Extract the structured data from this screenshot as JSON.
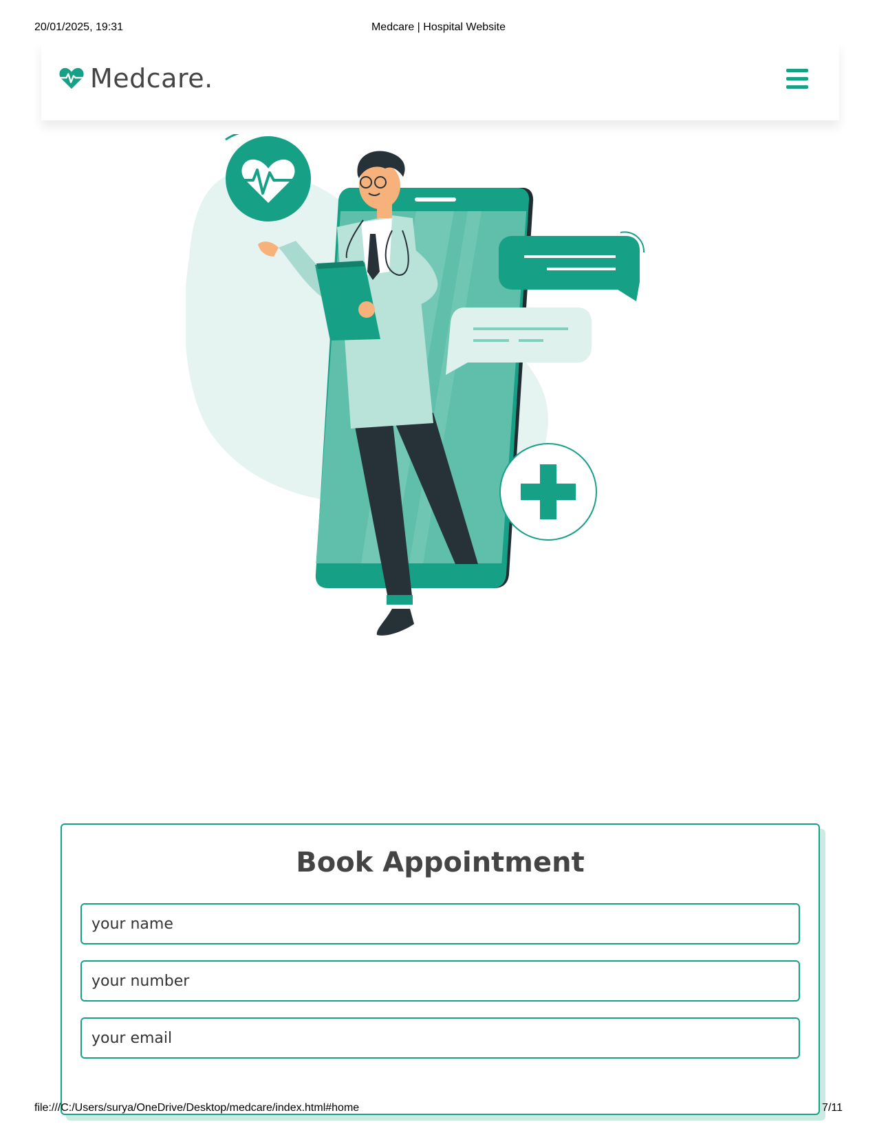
{
  "print": {
    "datetime": "20/01/2025, 19:31",
    "page_title": "Medcare | Hospital Website",
    "url": "file:///C:/Users/surya/OneDrive/Desktop/medcare/index.html#home",
    "page_number": "7/11"
  },
  "navbar": {
    "logo_text": "Medcare.",
    "logo_icon": "heartbeat-icon",
    "menu_icon": "hamburger-menu-icon"
  },
  "colors": {
    "accent": "#16a085",
    "text_dark": "#444444",
    "light_mint": "#e6f4f1"
  },
  "appointment": {
    "title": "Book Appointment",
    "name_placeholder": "your name",
    "number_placeholder": "your number",
    "email_placeholder": "your email"
  }
}
